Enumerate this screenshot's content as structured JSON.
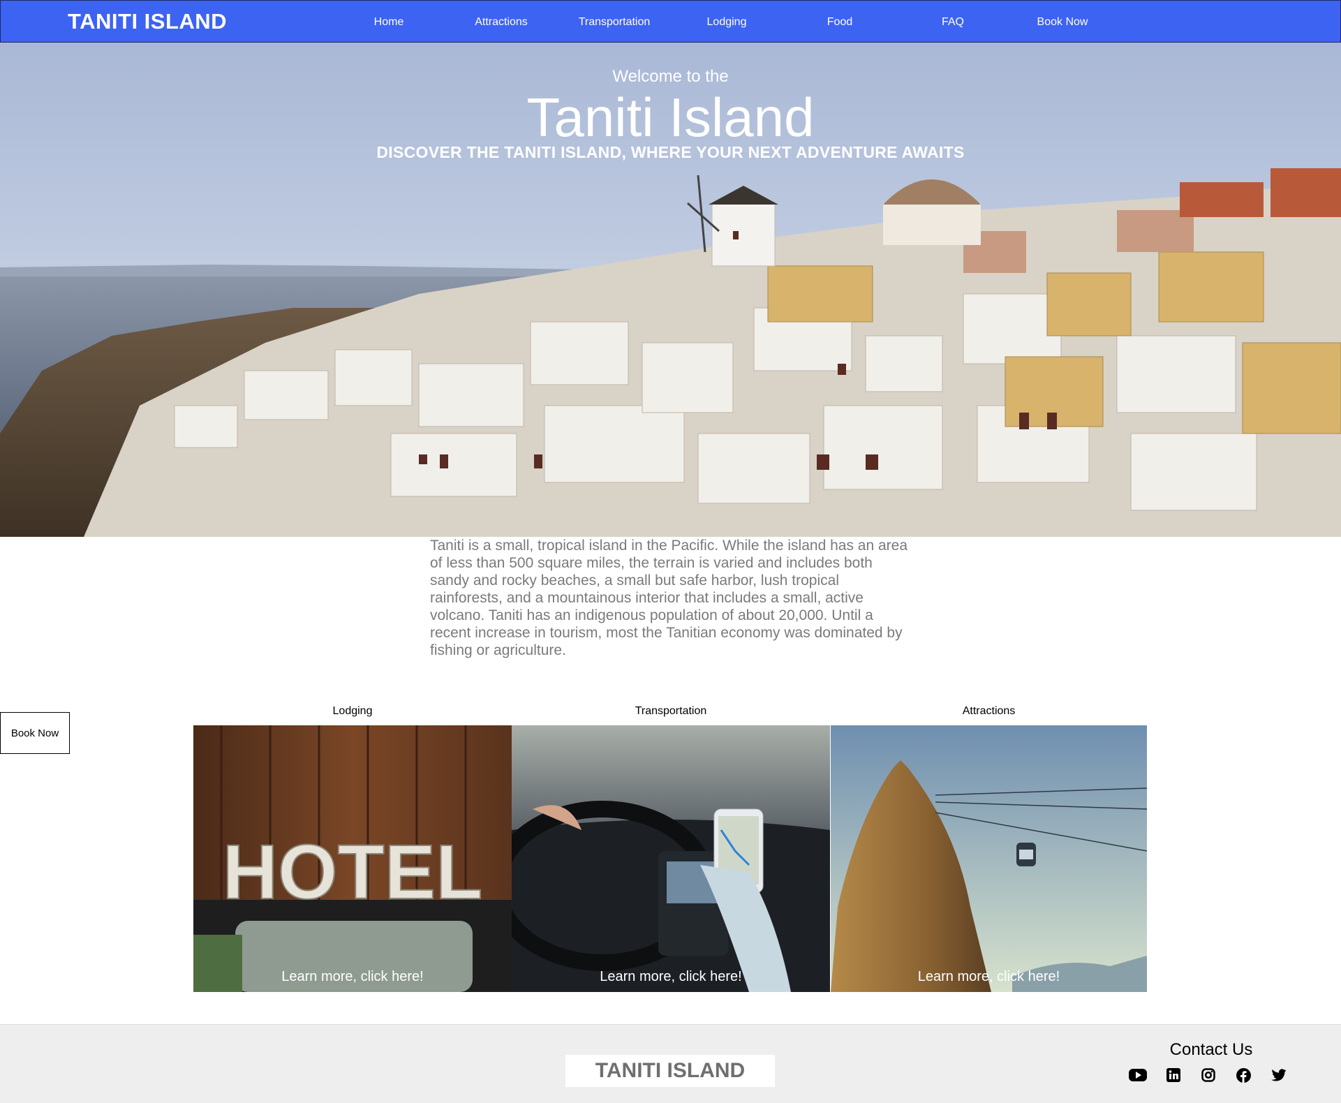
{
  "nav": {
    "brand": "TANITI ISLAND",
    "links": [
      {
        "label": "Home"
      },
      {
        "label": "Attractions"
      },
      {
        "label": "Transportation"
      },
      {
        "label": "Lodging"
      },
      {
        "label": "Food"
      },
      {
        "label": "FAQ"
      },
      {
        "label": "Book Now"
      }
    ]
  },
  "hero": {
    "welcome": "Welcome to the",
    "title": "Taniti Island",
    "subtitle": "DISCOVER THE TANITI ISLAND, WHERE YOUR NEXT ADVENTURE AWAITS"
  },
  "intro": {
    "text": "Taniti is a small, tropical island in the Pacific. While the island has an area of less than 500 square miles, the terrain is varied and includes both sandy and rocky beaches, a small but safe harbor, lush tropical rainforests, and a mountainous interior that includes a small, active volcano. Taniti has an indigenous population of about 20,000. Until a recent increase in tourism, most the Tanitian economy was dominated by fishing or agriculture."
  },
  "side_button": {
    "label": "Book Now"
  },
  "cards": [
    {
      "label": "Lodging",
      "cta": "Learn more, click here!",
      "image_text": "HOTEL"
    },
    {
      "label": "Transportation",
      "cta": "Learn more, click here!"
    },
    {
      "label": "Attractions",
      "cta": "Learn more, click here!"
    }
  ],
  "footer": {
    "brand": "TANITI ISLAND",
    "contact_title": "Contact Us",
    "social_icons": [
      "youtube-icon",
      "linkedin-icon",
      "instagram-icon",
      "facebook-icon",
      "twitter-icon"
    ]
  },
  "colors": {
    "nav_bg": "#3d63f3",
    "footer_bg": "#eeeeee",
    "intro_text": "#7a7a7a"
  }
}
